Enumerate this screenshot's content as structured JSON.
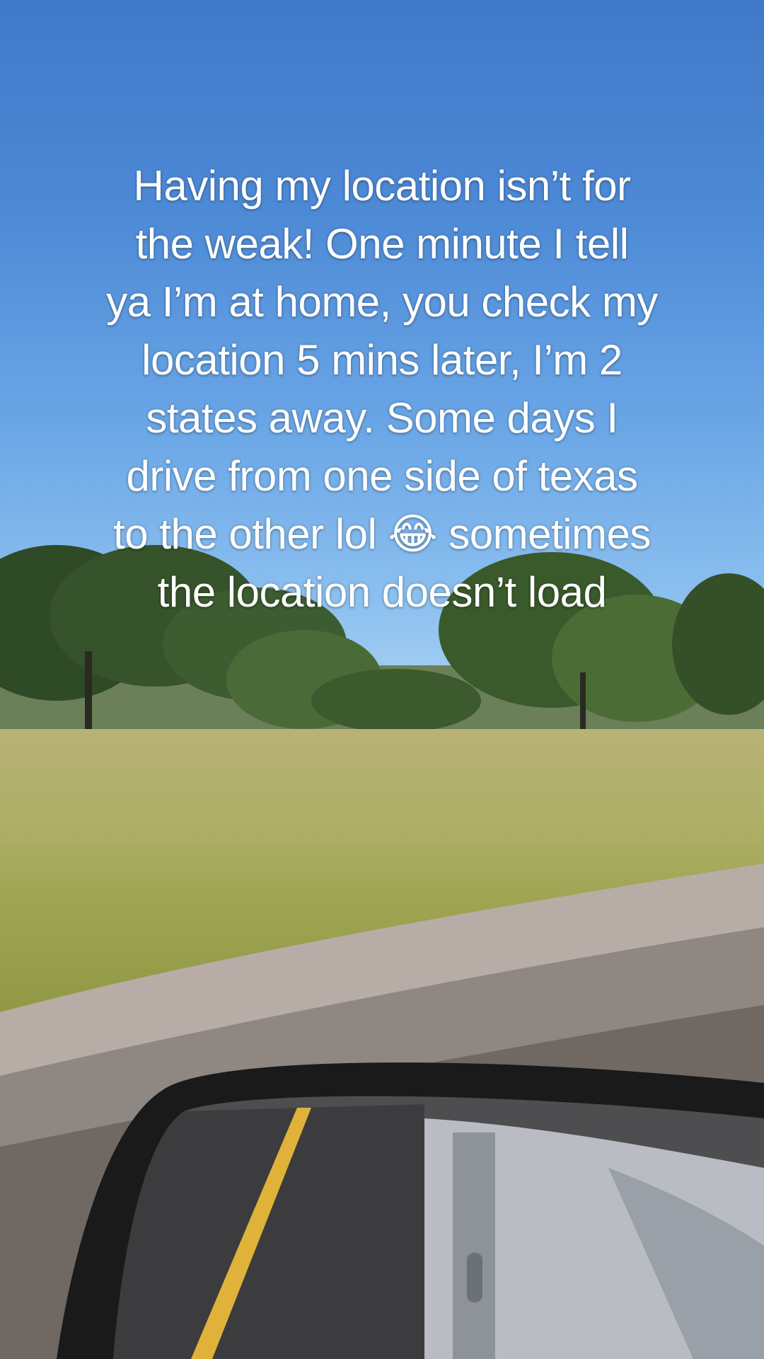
{
  "caption": {
    "lines": [
      "Having my location isn’t for",
      "the weak! One minute I tell",
      "ya I’m at home, you check my",
      "location 5 mins later, I’m 2",
      "states away. Some days I",
      "drive from one side of texas",
      "to the other lol 😂 sometimes",
      "the location doesn’t load"
    ]
  },
  "colors": {
    "sky_top": "#3f78c8",
    "sky_bottom": "#a9d2f3",
    "grass": "#aeb067",
    "road_center_line": "#e0b23a",
    "mirror_housing": "#1a1a1a"
  }
}
